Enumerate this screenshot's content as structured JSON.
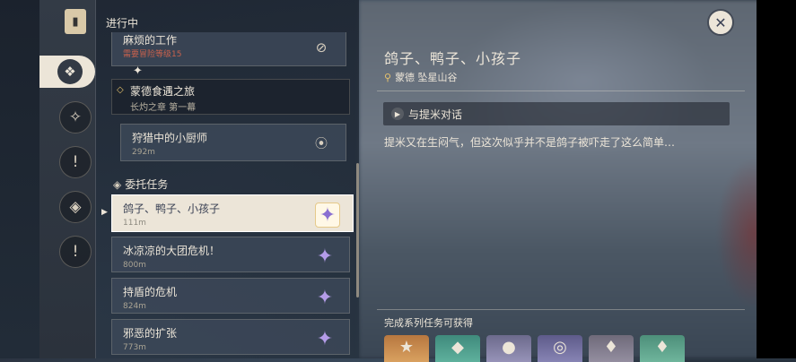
{
  "header": {
    "tab_title": "进行中"
  },
  "rail": {
    "icons": [
      "quest-book-icon",
      "diamond-cluster-icon",
      "compass-icon",
      "daily-commission-icon",
      "world-quest-icon",
      "exclamation-icon"
    ]
  },
  "quests_top": [
    {
      "name": "麻烦的工作",
      "sub": "需要冒险等级15"
    },
    {
      "name": "蒙德食遇之旅",
      "sub": "长灼之章 第一幕"
    },
    {
      "name": "狩猎中的小厨师",
      "dist": "292m"
    }
  ],
  "commission_header": "委托任务",
  "commissions": [
    {
      "name": "鸽子、鸭子、小孩子",
      "dist": "111m"
    },
    {
      "name": "冰凉凉的大团危机！",
      "dist": "800m"
    },
    {
      "name": "持盾的危机",
      "dist": "824m"
    },
    {
      "name": "邪恶的扩张",
      "dist": "773m"
    }
  ],
  "detail": {
    "title": "鸽子、鸭子、小孩子",
    "location": "蒙德 坠星山谷",
    "step": "与提米对话",
    "description": "提米又在生闷气，但这次似乎并不是鸽子被吓走了这么简单…",
    "rewards_title": "完成系列任务可获得"
  },
  "colors": {
    "panel": "#ece5d8",
    "star": "#b49ce8",
    "pin": "#e7c36d"
  }
}
